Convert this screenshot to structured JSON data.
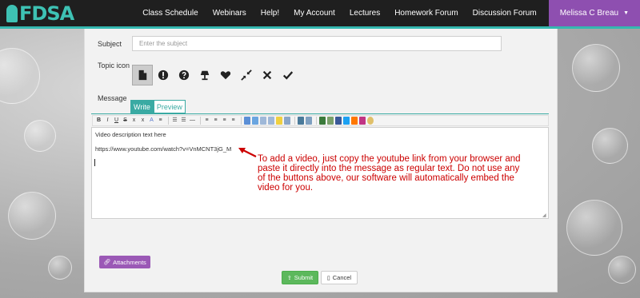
{
  "brand": {
    "logo_text": "FDSA",
    "accent": "#34b8b0",
    "purple": "#8e4fb0"
  },
  "nav": {
    "items": [
      {
        "label": "Class Schedule"
      },
      {
        "label": "Webinars"
      },
      {
        "label": "Help!"
      },
      {
        "label": "My Account"
      },
      {
        "label": "Lectures"
      },
      {
        "label": "Homework Forum"
      },
      {
        "label": "Discussion Forum"
      }
    ],
    "user": {
      "label": "Melissa C Breau",
      "caret": "▼"
    }
  },
  "form": {
    "subject_label": "Subject",
    "subject_placeholder": "Enter the subject",
    "topic_icon_label": "Topic icon",
    "topic_icons": [
      "document-icon",
      "exclamation-icon",
      "question-icon",
      "lamp-icon",
      "heart-icon",
      "compress-icon",
      "times-icon",
      "check-icon"
    ],
    "message_label": "Message",
    "tabs": {
      "write": "Write",
      "preview": "Preview"
    },
    "toolbar": {
      "bold": "B",
      "italic": "I",
      "underline": "U",
      "strike": "S",
      "subscript": "x",
      "superscript": "x",
      "font": "A"
    },
    "editor": {
      "line1": "Video description text here",
      "line2": "https://www.youtube.com/watch?v=VnMCNT3jG_M"
    },
    "annotation": "To add a video, just copy the youtube link from your browser and paste it directly into the message as regular text. Do not use any of the buttons above, our software will automatically embed the video for you.",
    "attachments_label": "Attachments",
    "submit_label": "Submit",
    "cancel_label": "Cancel"
  }
}
